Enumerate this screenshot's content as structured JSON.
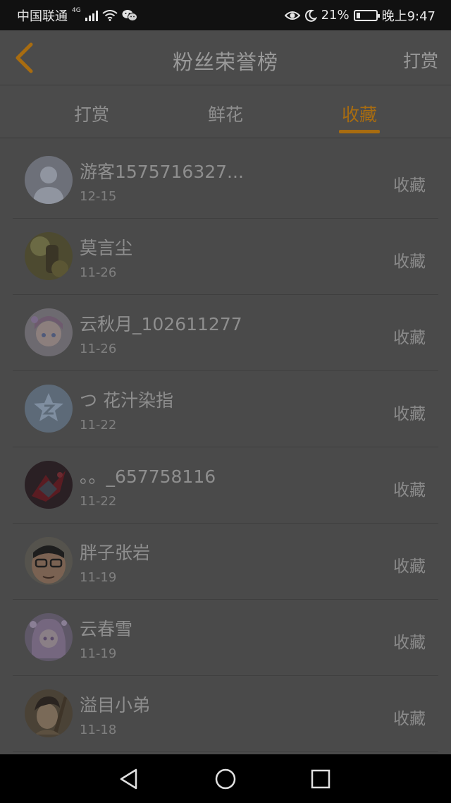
{
  "status_bar": {
    "carrier": "中国联通",
    "network": "4G",
    "battery": "21%",
    "time": "晚上9:47"
  },
  "header": {
    "title": "粉丝荣誉榜",
    "action_label": "打赏"
  },
  "tabs": [
    {
      "label": "打赏",
      "active": false
    },
    {
      "label": "鲜花",
      "active": false
    },
    {
      "label": "收藏",
      "active": true
    }
  ],
  "accent_color": "#a86c10",
  "list": [
    {
      "name": "游客1575716327...",
      "date": "12-15",
      "action": "收藏"
    },
    {
      "name": "莫言尘",
      "date": "11-26",
      "action": "收藏"
    },
    {
      "name": "云秋月_102611277",
      "date": "11-26",
      "action": "收藏"
    },
    {
      "name": "つ 花汁染指",
      "date": "11-22",
      "action": "收藏"
    },
    {
      "name": "。。_657758116",
      "date": "11-22",
      "action": "收藏"
    },
    {
      "name": "胖子张岩",
      "date": "11-19",
      "action": "收藏"
    },
    {
      "name": "云春雪",
      "date": "11-19",
      "action": "收藏"
    },
    {
      "name": "溢目小弟",
      "date": "11-18",
      "action": "收藏"
    }
  ]
}
